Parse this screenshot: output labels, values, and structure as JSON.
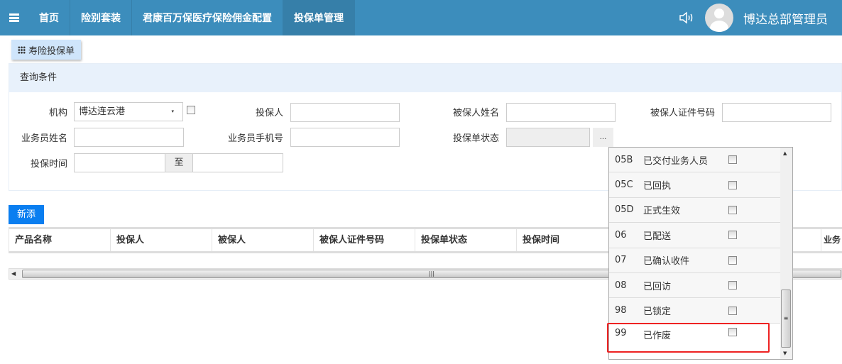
{
  "header": {
    "nav": [
      "首页",
      "险别套装",
      "君康百万保医疗保险佣金配置",
      "投保单管理"
    ],
    "active_index": 3,
    "user": "博达总部管理员"
  },
  "tab": {
    "label": "寿险投保单"
  },
  "query": {
    "title": "查询条件",
    "org_label": "机构",
    "org_value": "博达连云港",
    "applicant_label": "投保人",
    "insured_name_label": "被保人姓名",
    "insured_id_label": "被保人证件号码",
    "agent_name_label": "业务员姓名",
    "agent_phone_label": "业务员手机号",
    "status_label": "投保单状态",
    "status_button": "...",
    "time_label": "投保时间",
    "time_to": "至"
  },
  "add_button": "新添",
  "table": {
    "columns": [
      "产品名称",
      "投保人",
      "被保人",
      "被保人证件号码",
      "投保单状态",
      "投保时间",
      "",
      "",
      "业务"
    ]
  },
  "status_options": [
    {
      "code": "05B",
      "name": "已交付业务人员",
      "checked": false
    },
    {
      "code": "05C",
      "name": "已回执",
      "checked": false
    },
    {
      "code": "05D",
      "name": "正式生效",
      "checked": false
    },
    {
      "code": "06",
      "name": "已配送",
      "checked": false
    },
    {
      "code": "07",
      "name": "已确认收件",
      "checked": false
    },
    {
      "code": "08",
      "name": "已回访",
      "checked": false
    },
    {
      "code": "98",
      "name": "已锁定",
      "checked": false
    },
    {
      "code": "99",
      "name": "已作废",
      "checked": false
    }
  ],
  "colors": {
    "header": "#3c8dbc",
    "active": "#367fa9",
    "add": "#0a7ef0",
    "highlight": "#e22222"
  }
}
